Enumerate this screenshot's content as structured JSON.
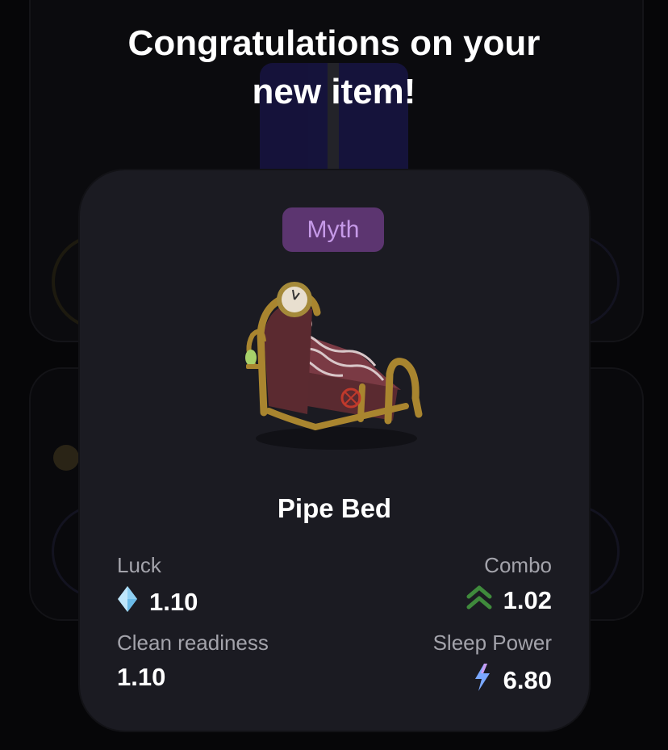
{
  "header": {
    "line1": "Congratulations on your",
    "line2": "new item!"
  },
  "item": {
    "rarity": "Myth",
    "name": "Pipe Bed",
    "image_icon": "pipe-bed-icon",
    "stats": {
      "luck": {
        "label": "Luck",
        "value": "1.10",
        "icon": "diamond-icon"
      },
      "combo": {
        "label": "Combo",
        "value": "1.02",
        "icon": "double-chevron-up-icon"
      },
      "clean_readiness": {
        "label": "Clean readiness",
        "value": "1.10"
      },
      "sleep_power": {
        "label": "Sleep Power",
        "value": "6.80",
        "icon": "lightning-icon"
      }
    }
  },
  "colors": {
    "background": "#060608",
    "card": "#1b1b22",
    "rarity_badge_bg": "#5c3570",
    "rarity_badge_text": "#c69ae8",
    "label_text": "#a3a3ab",
    "combo_green": "#3f8a3c",
    "lightning_blue": "#7aa8ff"
  }
}
